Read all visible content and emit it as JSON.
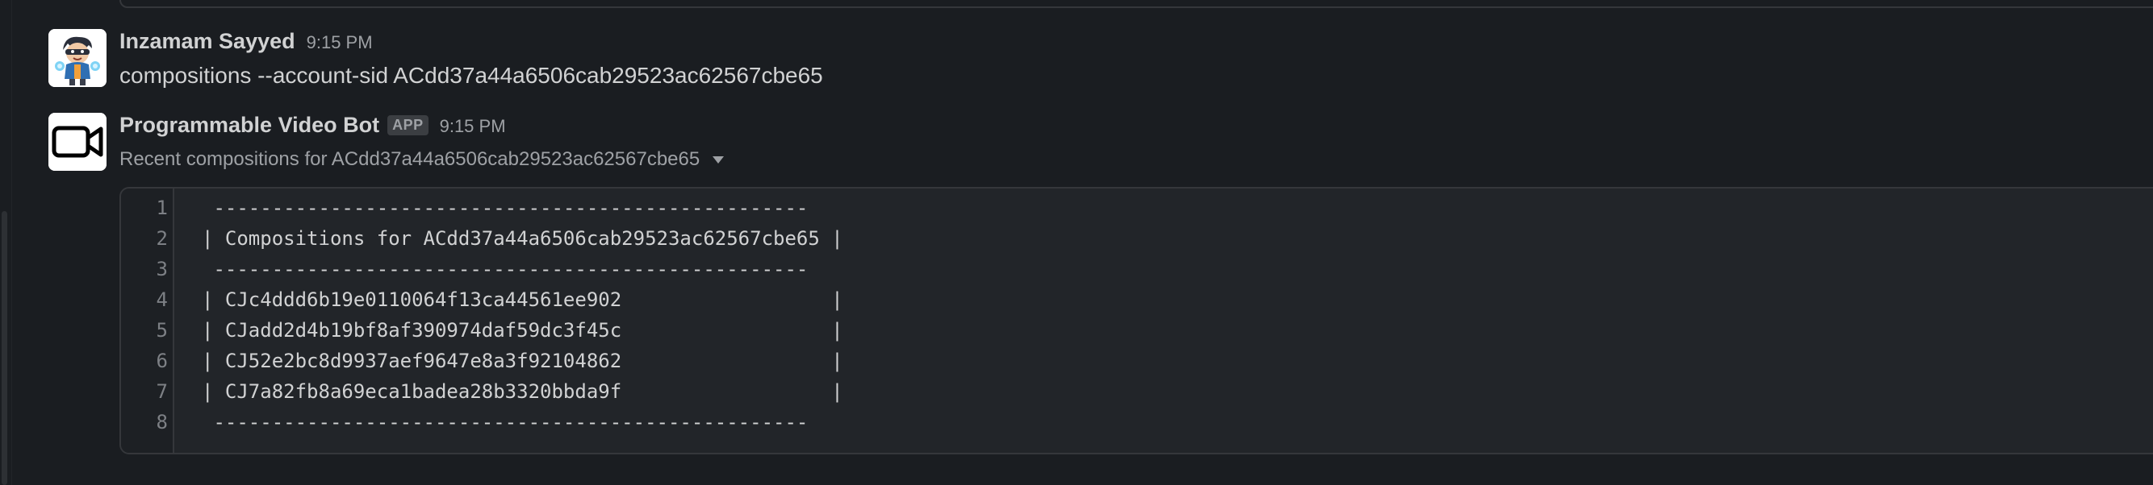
{
  "messages": [
    {
      "author": "Inzamam Sayyed",
      "time": "9:15 PM",
      "text": "compositions --account-sid ACdd37a44a6506cab29523ac62567cbe65",
      "avatar_icon": "cartoon-boy-avatar-icon"
    },
    {
      "author": "Programmable Video Bot",
      "badge": "APP",
      "time": "9:15 PM",
      "attachment_title": "Recent compositions for ACdd37a44a6506cab29523ac62567cbe65",
      "avatar_icon": "video-camera-icon"
    }
  ],
  "code_block": {
    "line_numbers": [
      "1",
      "2",
      "3",
      "4",
      "5",
      "6",
      "7",
      "8"
    ],
    "lines": [
      " ---------------------------------------------------",
      "| Compositions for ACdd37a44a6506cab29523ac62567cbe65 |",
      " ---------------------------------------------------",
      "| CJc4ddd6b19e0110064f13ca44561ee902                  |",
      "| CJadd2d4b19bf8af390974daf59dc3f45c                  |",
      "| CJ52e2bc8d9937aef9647e8a3f92104862                  |",
      "| CJ7a82fb8a69eca1badea28b3320bbda9f                  |",
      " ---------------------------------------------------"
    ]
  },
  "colors": {
    "background": "#1a1d21",
    "text": "#d1d2d3",
    "muted": "#9ea1a5",
    "code_bg": "#222529",
    "border": "#35373b"
  }
}
